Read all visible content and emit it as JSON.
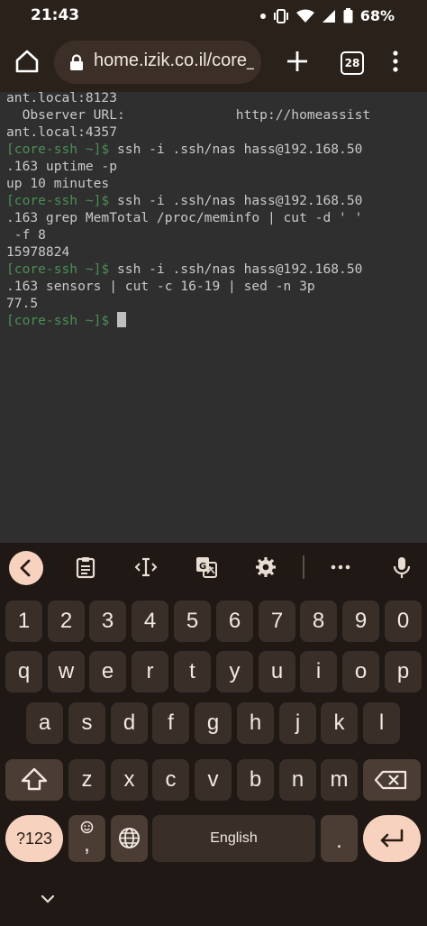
{
  "status_bar": {
    "time": "21:43",
    "battery": "68%",
    "icons": [
      "notification-dot-icon",
      "vibrate-icon",
      "wifi-icon",
      "signal-icon",
      "battery-icon"
    ]
  },
  "browser": {
    "url": "home.izik.co.il/core_",
    "tab_count": "28",
    "icons": [
      "home-icon",
      "lock-icon",
      "plus-icon",
      "menu-icon"
    ]
  },
  "terminal": {
    "lines": [
      {
        "text": "ant.local:8123"
      },
      {
        "text": "  Observer URL:              http://homeassist"
      },
      {
        "text": "ant.local:4357"
      },
      {
        "prompt": "[core-ssh ~]$",
        "cmd": " ssh -i .ssh/nas hass@192.168.50"
      },
      {
        "text": ".163 uptime -p"
      },
      {
        "text": "up 10 minutes"
      },
      {
        "prompt": "[core-ssh ~]$",
        "cmd": " ssh -i .ssh/nas hass@192.168.50"
      },
      {
        "text": ".163 grep MemTotal /proc/meminfo | cut -d ' '"
      },
      {
        "text": " -f 8"
      },
      {
        "text": "15978824"
      },
      {
        "prompt": "[core-ssh ~]$",
        "cmd": " ssh -i .ssh/nas hass@192.168.50"
      },
      {
        "text": ".163 sensors | cut -c 16-19 | sed -n 3p"
      },
      {
        "text": "77.5"
      },
      {
        "prompt": "[core-ssh ~]$",
        "cmd": " "
      }
    ],
    "colors": {
      "background": "#2f2f2f",
      "text": "#c9c9c9",
      "prompt": "#4b8f54"
    }
  },
  "keyboard": {
    "row_numbers": [
      "1",
      "2",
      "3",
      "4",
      "5",
      "6",
      "7",
      "8",
      "9",
      "0"
    ],
    "row_1": [
      "q",
      "w",
      "e",
      "r",
      "t",
      "y",
      "u",
      "i",
      "o",
      "p"
    ],
    "row_2": [
      "a",
      "s",
      "d",
      "f",
      "g",
      "h",
      "j",
      "k",
      "l"
    ],
    "row_3": [
      "z",
      "x",
      "c",
      "v",
      "b",
      "n",
      "m"
    ],
    "symbols_key": "?123",
    "emoji_comma": ",",
    "space_label": "English",
    "period": ".",
    "toolbar_icons": [
      "back-chevron-icon",
      "clipboard-icon",
      "text-cursor-icon",
      "translate-icon",
      "settings-gear-icon",
      "more-icon",
      "microphone-icon"
    ],
    "colors": {
      "accent": "#f7d2bf",
      "key": "#3a2f28",
      "background": "#1f1814"
    }
  }
}
